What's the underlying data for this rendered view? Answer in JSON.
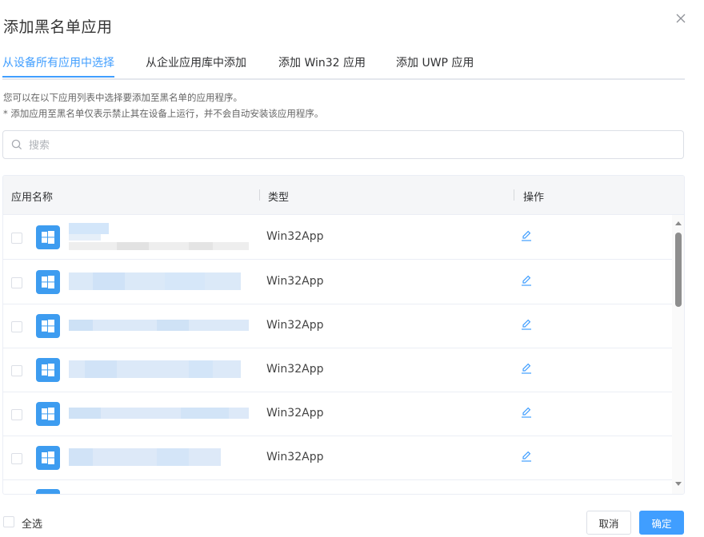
{
  "dialog": {
    "title": "添加黑名单应用",
    "tabs": [
      {
        "label": "从设备所有应用中选择",
        "active": true
      },
      {
        "label": "从企业应用库中添加",
        "active": false
      },
      {
        "label": "添加 Win32 应用",
        "active": false
      },
      {
        "label": "添加 UWP 应用",
        "active": false
      }
    ],
    "hint_lines": [
      "您可以在以下应用列表中选择要添加至黑名单的应用程序。",
      "* 添加应用至黑名单仅表示禁止其在设备上运行，并不会自动安装该应用程序。"
    ],
    "search": {
      "placeholder": "搜索",
      "value": ""
    },
    "table": {
      "columns": [
        "应用名称",
        "类型",
        "操作"
      ],
      "rows": [
        {
          "type": "Win32App"
        },
        {
          "type": "Win32App"
        },
        {
          "type": "Win32App"
        },
        {
          "type": "Win32App"
        },
        {
          "type": "Win32App"
        },
        {
          "type": "Win32App"
        }
      ]
    },
    "footer": {
      "select_all": "全选",
      "cancel": "取消",
      "ok": "确定"
    }
  },
  "colors": {
    "accent": "#409eff",
    "app_icon": "#3d9cf0",
    "border": "#dcdfe6",
    "header_bg": "#f5f6f8"
  },
  "icons": {
    "close": "close-icon",
    "search": "search-icon",
    "app": "windows-logo-icon",
    "edit": "edit-icon"
  }
}
